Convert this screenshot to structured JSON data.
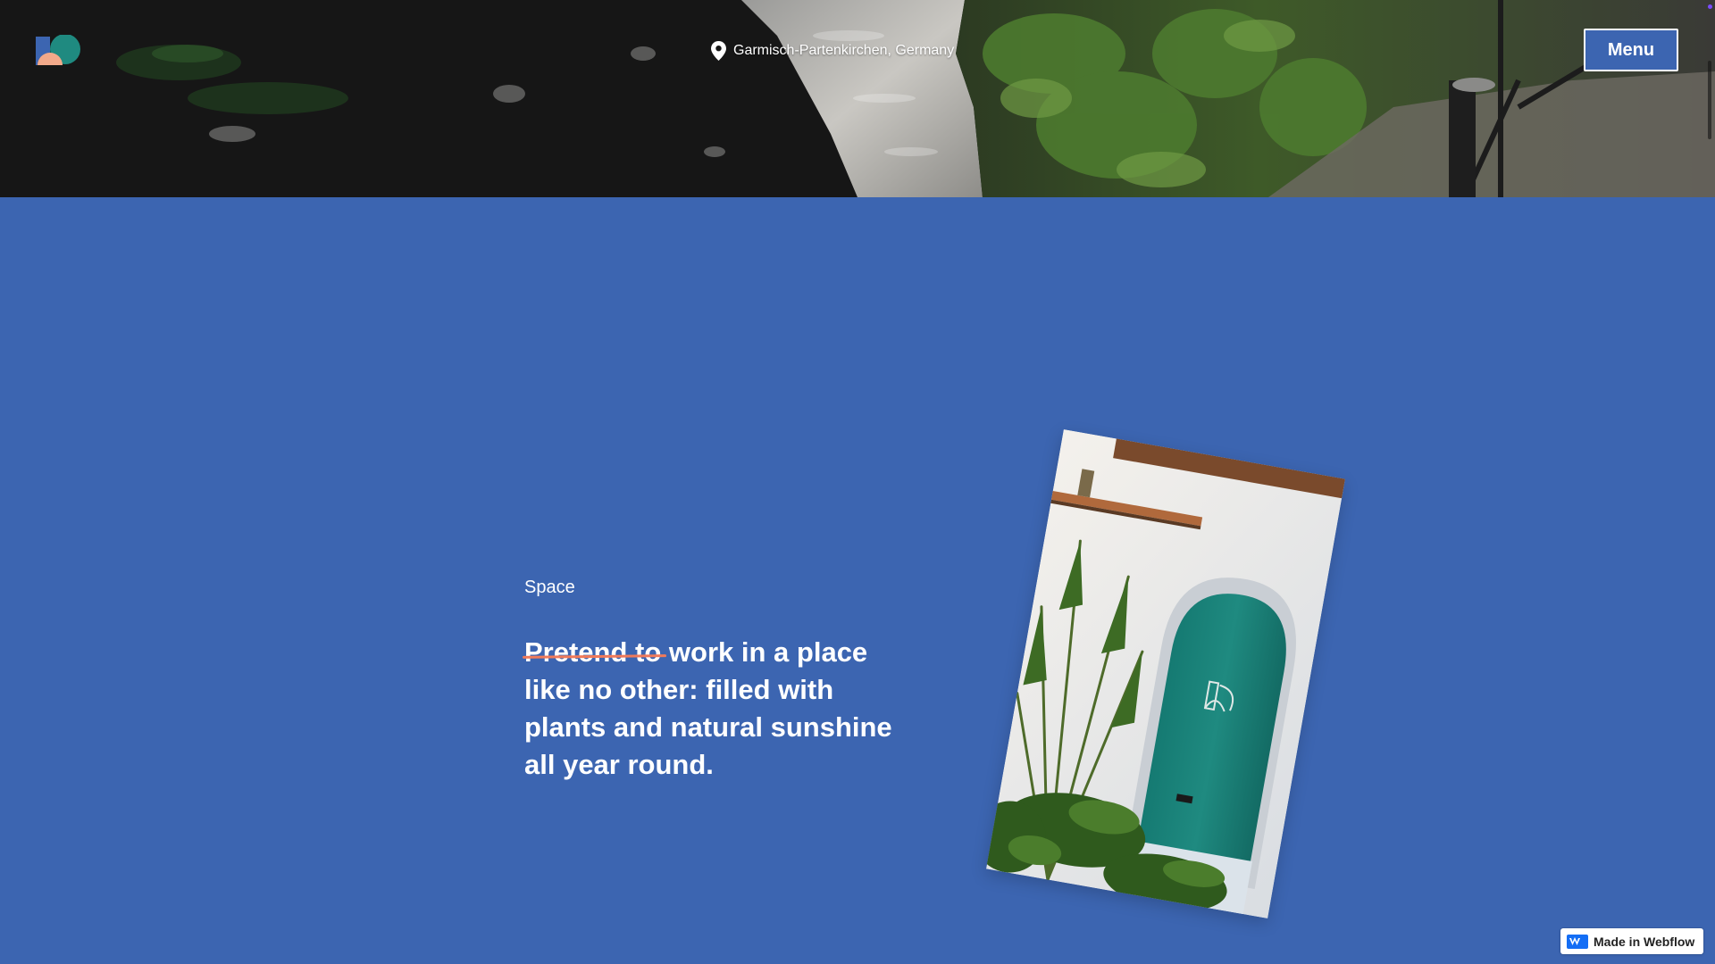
{
  "header": {
    "logo_icon": "brand-logo-icon",
    "location_icon": "map-pin-icon",
    "location": "Garmisch-Partenkirchen, Germany",
    "menu_label": "Menu"
  },
  "section": {
    "eyebrow": "Space",
    "headline_struck": "Pretend to",
    "headline_rest": "work in a place like no other: filled with plants and natural sunshine all year round."
  },
  "badge": {
    "icon": "webflow-logo-icon",
    "label": "Made in Webflow"
  },
  "colors": {
    "section_background": "#3c65b1",
    "menu_button": "#3c65b1",
    "strike_accent": "#f07a5a",
    "door_teal": "#1f8a80"
  }
}
